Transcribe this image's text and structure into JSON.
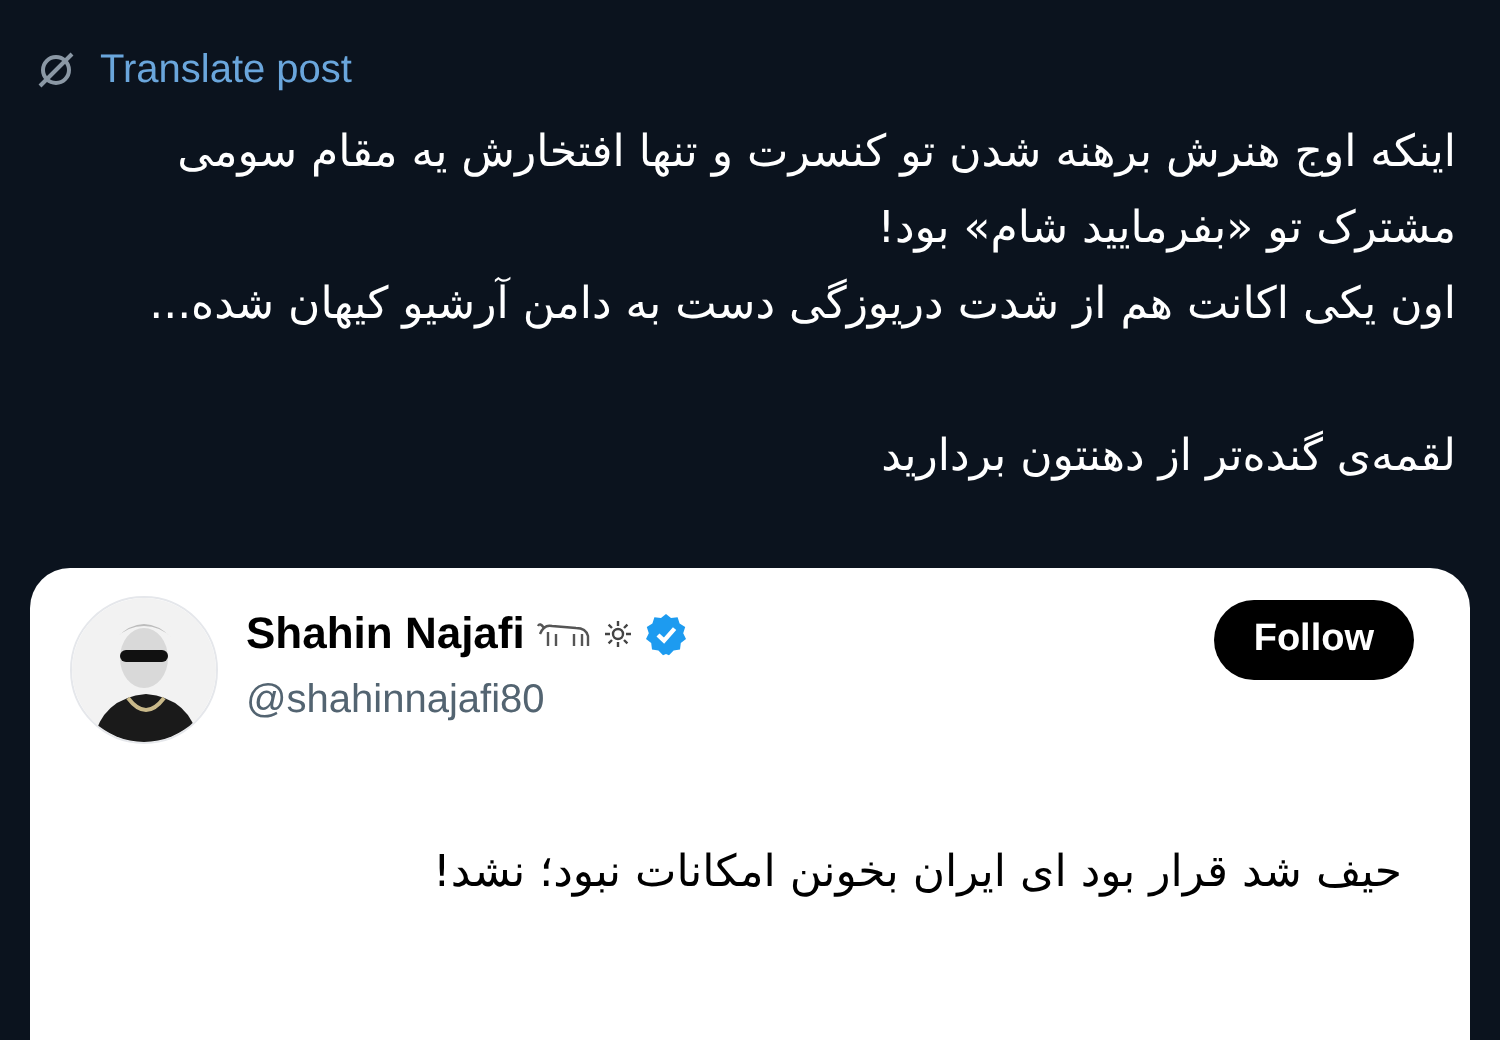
{
  "translate": {
    "label": "Translate post"
  },
  "post": {
    "blocks": [
      {
        "lines": [
          "اینکه اوج هنرش برهنه شدن تو کنسرت و تنها افتخارش یه مقام سومی مشترک تو «بفرمایید شام» بود!",
          "اون یکی اکانت هم از شدت دریوزگی دست به دامن آرشیو کیهان شده..."
        ]
      },
      {
        "lines": [
          "لقمه‌ی گنده‌تر از دهنتون بردارید"
        ]
      }
    ]
  },
  "quoted": {
    "name": "Shahin Najafi",
    "verified": true,
    "handle": "@shahinnajafi80",
    "follow": "Follow",
    "text": "حیف شد قرار بود ای ایران بخونن امکانات نبود؛ نشد!"
  }
}
